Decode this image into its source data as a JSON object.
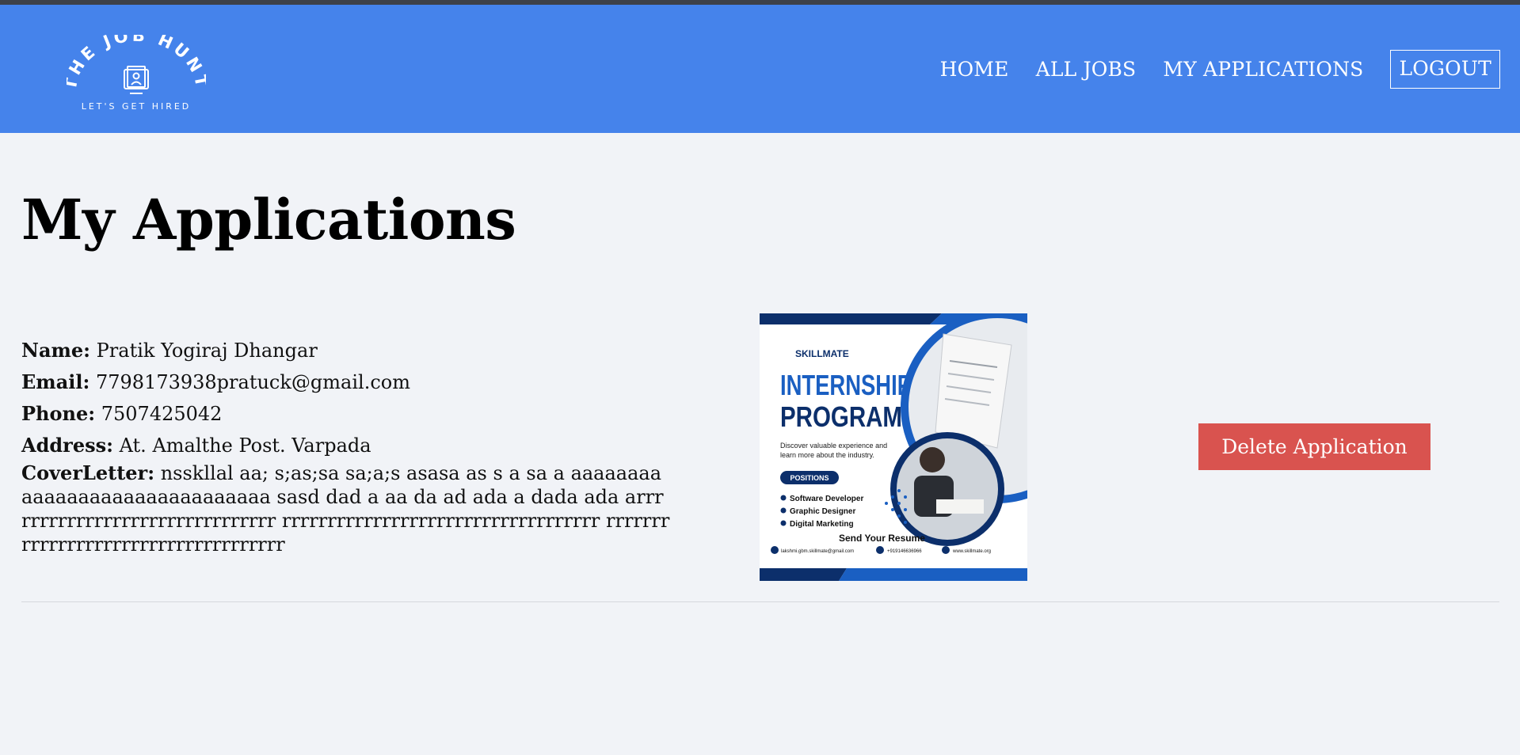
{
  "brand": {
    "logo_text": "THE JOB HUNT",
    "tagline": "LET'S GET HIRED"
  },
  "nav": {
    "home": "HOME",
    "all_jobs": "ALL JOBS",
    "my_applications": "MY APPLICATIONS",
    "logout": "LOGOUT"
  },
  "page": {
    "title": "My Applications"
  },
  "application": {
    "name_label": "Name:",
    "name": "Pratik Yogiraj Dhangar",
    "email_label": "Email:",
    "email": "7798173938pratuck@gmail.com",
    "phone_label": "Phone:",
    "phone": "7507425042",
    "address_label": "Address:",
    "address": "At. Amalthe Post. Varpada",
    "cover_label": "CoverLetter:",
    "cover": "nsskllal aa; s;as;sa sa;a;s asasa as s a sa a aaaaaaaaaaaaaaaaaaaaaaaaaaaaaa sasd dad a aa da ad ada a dada ada arrrrrrrrrrrrrrrrrrrrrrrrrrrrrrr rrrrrrrrrrrrrrrrrrrrrrrrrrrrrrrrrrr rrrrrrrrrrrrrrrrrrrrrrrrrrrrrrrrrrrr",
    "delete_label": "Delete Application"
  },
  "poster": {
    "brand": "SKILLMATE",
    "title_line1": "INTERNSHIP",
    "title_line2": "PROGRAM",
    "description_line1": "Discover valuable experience and",
    "description_line2": "learn more about the industry.",
    "positions_label": "POSITIONS",
    "positions": [
      "Software Developer",
      "Graphic Designer",
      "Digital Marketing"
    ],
    "cta": "Send Your Resume",
    "email": "lakshmi.gbm.skillmate@gmail.com",
    "phone": "+919146636966",
    "website": "www.skillmate.org"
  },
  "colors": {
    "navbar": "#4583eb",
    "background": "#f1f3f7",
    "delete_button": "#d9534f",
    "poster_blue": "#1a5fc2",
    "poster_navy": "#0c2f6b"
  }
}
